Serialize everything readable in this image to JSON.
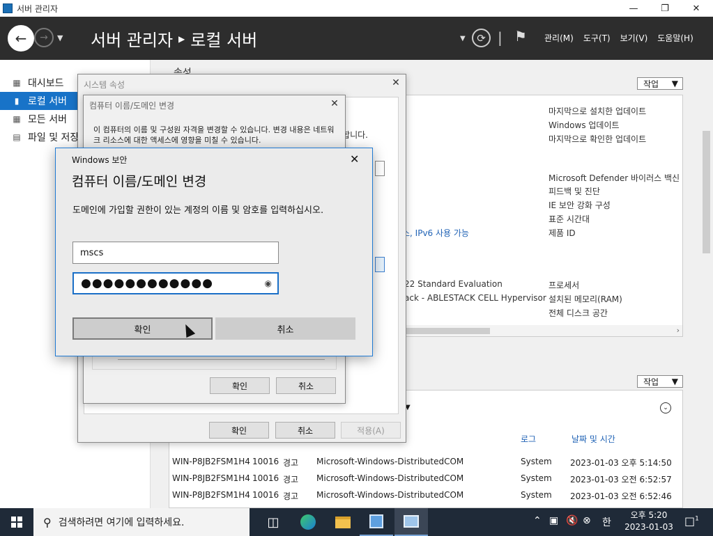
{
  "window": {
    "title": "서버 관리자"
  },
  "header": {
    "breadcrumb_root": "서버 관리자",
    "breadcrumb_current": "로컬 서버",
    "menu": [
      "관리(M)",
      "도구(T)",
      "보기(V)",
      "도움말(H)"
    ]
  },
  "sidebar": {
    "items": [
      {
        "label": "대시보드"
      },
      {
        "label": "로컬 서버"
      },
      {
        "label": "모든 서버"
      },
      {
        "label": "파일 및 저장"
      }
    ]
  },
  "main": {
    "props_title": "속성",
    "task_label": "작업",
    "right_labels": [
      "마지막으로 설치한 업데이트",
      "Windows 업데이트",
      "마지막으로 확인한 업데이트",
      "Microsoft Defender 바이러스 백신",
      "피드백 및 진단",
      "IE 보안 강화 구성",
      "표준 시간대",
      "제품 ID",
      "프로세서",
      "설치된 메모리(RAM)",
      "전체 디스크 공간"
    ],
    "left_values": {
      "network": "스, IPv6 사용 가능",
      "os": "22 Standard Evaluation",
      "hw": "ack - ABLESTACK CELL Hypervisor"
    },
    "events": {
      "col_log": "로그",
      "col_datetime": "날짜 및 시간",
      "rows": [
        {
          "server": "WIN-P8JB2FSM1H4",
          "id": "10016",
          "level": "경고",
          "source": "Microsoft-Windows-DistributedCOM",
          "log": "System",
          "datetime": "2023-01-03 오후 5:14:50"
        },
        {
          "server": "WIN-P8JB2FSM1H4",
          "id": "10016",
          "level": "경고",
          "source": "Microsoft-Windows-DistributedCOM",
          "log": "System",
          "datetime": "2023-01-03 오전 6:52:57"
        },
        {
          "server": "WIN-P8JB2FSM1H4",
          "id": "10016",
          "level": "경고",
          "source": "Microsoft-Windows-DistributedCOM",
          "log": "System",
          "datetime": "2023-01-03 오전 6:52:46"
        }
      ]
    }
  },
  "sysprops": {
    "title": "시스템 속성",
    "text_tail": "인합니다.",
    "ok": "확인",
    "cancel": "취소",
    "apply": "적용(A)"
  },
  "cnchange": {
    "title": "컴퓨터 이름/도메인 변경",
    "desc": "이 컴퓨터의 이름 및 구성원 자격을 변경할 수 있습니다. 변경 내용은 네트워크 리소스에 대한 액세스에 영향을 미칠 수 있습니다.",
    "ok": "확인",
    "cancel": "취소"
  },
  "winsec": {
    "caption": "Windows 보안",
    "heading": "컴퓨터 이름/도메인 변경",
    "prompt": "도메인에 가입할 권한이 있는 계정의 이름 및 암호를 입력하십시오.",
    "username": "mscs",
    "password_mask": "●●●●●●●●●●●●",
    "ok": "확인",
    "cancel": "취소"
  },
  "taskbar": {
    "search_placeholder": "검색하려면 여기에 입력하세요.",
    "ime": "한",
    "time": "오후 5:20",
    "date": "2023-01-03",
    "notif_count": "1"
  }
}
